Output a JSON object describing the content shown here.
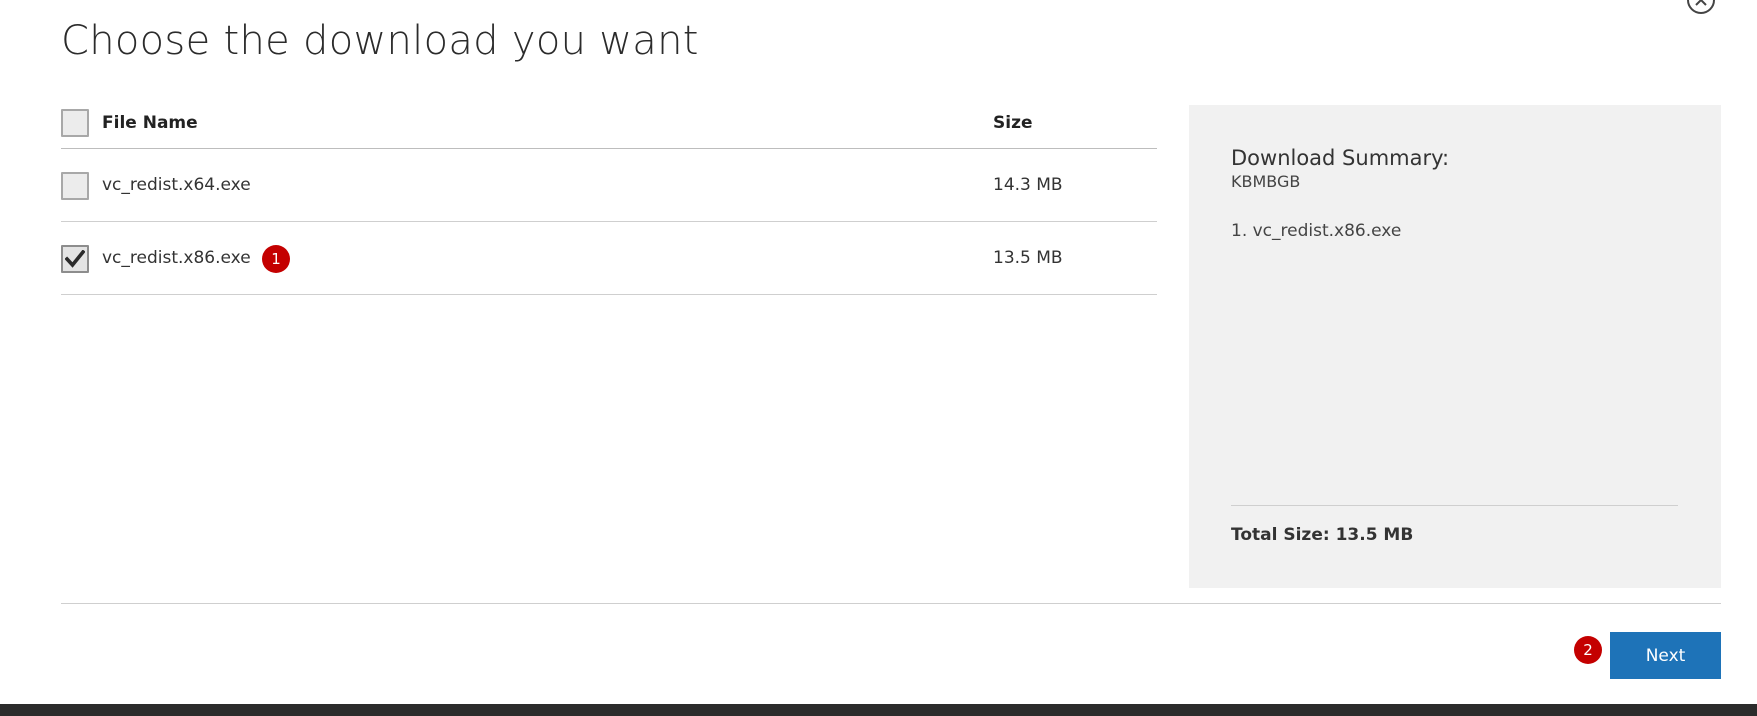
{
  "dialog": {
    "title": "Choose the download you want",
    "close_icon": "close-icon"
  },
  "table": {
    "headers": {
      "file_name": "File Name",
      "size": "Size"
    },
    "rows": [
      {
        "name": "vc_redist.x64.exe",
        "size": "14.3 MB",
        "checked": false
      },
      {
        "name": "vc_redist.x86.exe",
        "size": "13.5 MB",
        "checked": true
      }
    ]
  },
  "summary": {
    "title": "Download Summary:",
    "code": "KBMBGB",
    "items": [
      "1. vc_redist.x86.exe"
    ],
    "total": "Total Size: 13.5 MB"
  },
  "actions": {
    "next_label": "Next"
  },
  "annotations": {
    "marker1": "1",
    "marker2": "2"
  },
  "colors": {
    "accent": "#1e73b8",
    "annotation": "#c40000",
    "summary_bg": "#f1f1f1",
    "footer_bar": "#2b2b2b"
  }
}
